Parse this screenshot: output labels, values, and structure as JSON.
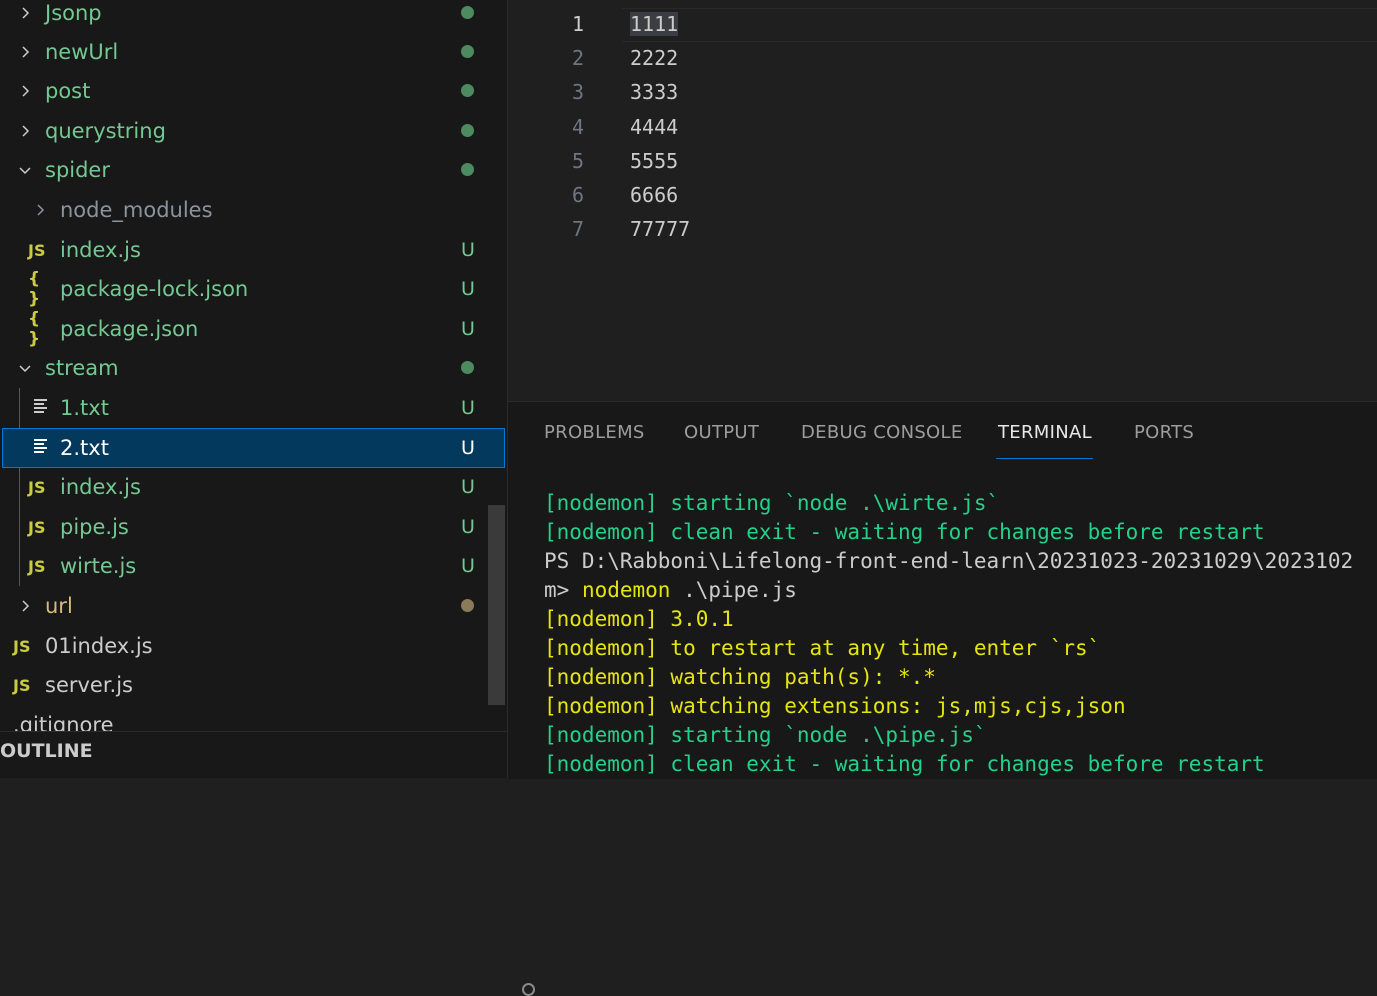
{
  "explorer": {
    "rows": [
      {
        "label": "Jsonp",
        "type": "folder",
        "expanded": false,
        "status": "dot"
      },
      {
        "label": "newUrl",
        "type": "folder",
        "expanded": false,
        "status": "dot"
      },
      {
        "label": "post",
        "type": "folder",
        "expanded": false,
        "status": "dot"
      },
      {
        "label": "querystring",
        "type": "folder",
        "expanded": false,
        "status": "dot"
      },
      {
        "label": "spider",
        "type": "folder",
        "expanded": true,
        "status": "dot"
      },
      {
        "label": "node_modules",
        "type": "folder",
        "expanded": false,
        "status": ""
      },
      {
        "label": "index.js",
        "type": "js",
        "status": "U"
      },
      {
        "label": "package-lock.json",
        "type": "json",
        "status": "U"
      },
      {
        "label": "package.json",
        "type": "json",
        "status": "U"
      },
      {
        "label": "stream",
        "type": "folder",
        "expanded": true,
        "status": "dot"
      },
      {
        "label": "1.txt",
        "type": "txt",
        "status": "U"
      },
      {
        "label": "2.txt",
        "type": "txt",
        "status": "U",
        "selected": true
      },
      {
        "label": "index.js",
        "type": "js",
        "status": "U"
      },
      {
        "label": "pipe.js",
        "type": "js",
        "status": "U"
      },
      {
        "label": "wirte.js",
        "type": "js",
        "status": "U"
      },
      {
        "label": "url",
        "type": "folder",
        "expanded": false,
        "status": "dot-brown"
      },
      {
        "label": "01index.js",
        "type": "js",
        "status": ""
      },
      {
        "label": "server.js",
        "type": "js",
        "status": ""
      },
      {
        "label": ".gitignore",
        "type": "plain",
        "status": ""
      }
    ],
    "js_badge": "JS",
    "json_badge": "{ }",
    "outline_label": "OUTLINE"
  },
  "editor": {
    "lines": [
      {
        "num": "1",
        "text": "1111"
      },
      {
        "num": "2",
        "text": "2222"
      },
      {
        "num": "3",
        "text": "3333"
      },
      {
        "num": "4",
        "text": "4444"
      },
      {
        "num": "5",
        "text": "5555"
      },
      {
        "num": "6",
        "text": "6666"
      },
      {
        "num": "7",
        "text": "77777"
      }
    ]
  },
  "panel": {
    "tabs": [
      "PROBLEMS",
      "OUTPUT",
      "DEBUG CONSOLE",
      "TERMINAL",
      "PORTS"
    ],
    "active_tab": "TERMINAL",
    "terminal_lines": [
      {
        "text": "[nodemon] starting `node .\\wirte.js`",
        "color": "green"
      },
      {
        "text": "[nodemon] clean exit - waiting for changes before restart",
        "color": "green"
      },
      {
        "text": "PS D:\\Rabboni\\Lifelong-front-end-learn\\20231023-20231029\\2023102",
        "color": "white"
      },
      {
        "text": "m> ",
        "color": "white",
        "cmd": "nodemon",
        "args": " .\\pipe.js"
      },
      {
        "text": "[nodemon] 3.0.1",
        "color": "yellow"
      },
      {
        "text": "[nodemon] to restart at any time, enter `rs`",
        "color": "yellow"
      },
      {
        "text": "[nodemon] watching path(s): *.*",
        "color": "yellow"
      },
      {
        "text": "[nodemon] watching extensions: js,mjs,cjs,json",
        "color": "yellow"
      },
      {
        "text": "[nodemon] starting `node .\\pipe.js`",
        "color": "green"
      },
      {
        "text": "[nodemon] clean exit - waiting for changes before restart",
        "color": "green"
      }
    ]
  },
  "colors": {
    "git_untracked": "#73c991",
    "selection": "#04395e",
    "accent": "#0078d4",
    "terminal_green": "#23d18b",
    "terminal_yellow": "#e5e510"
  }
}
